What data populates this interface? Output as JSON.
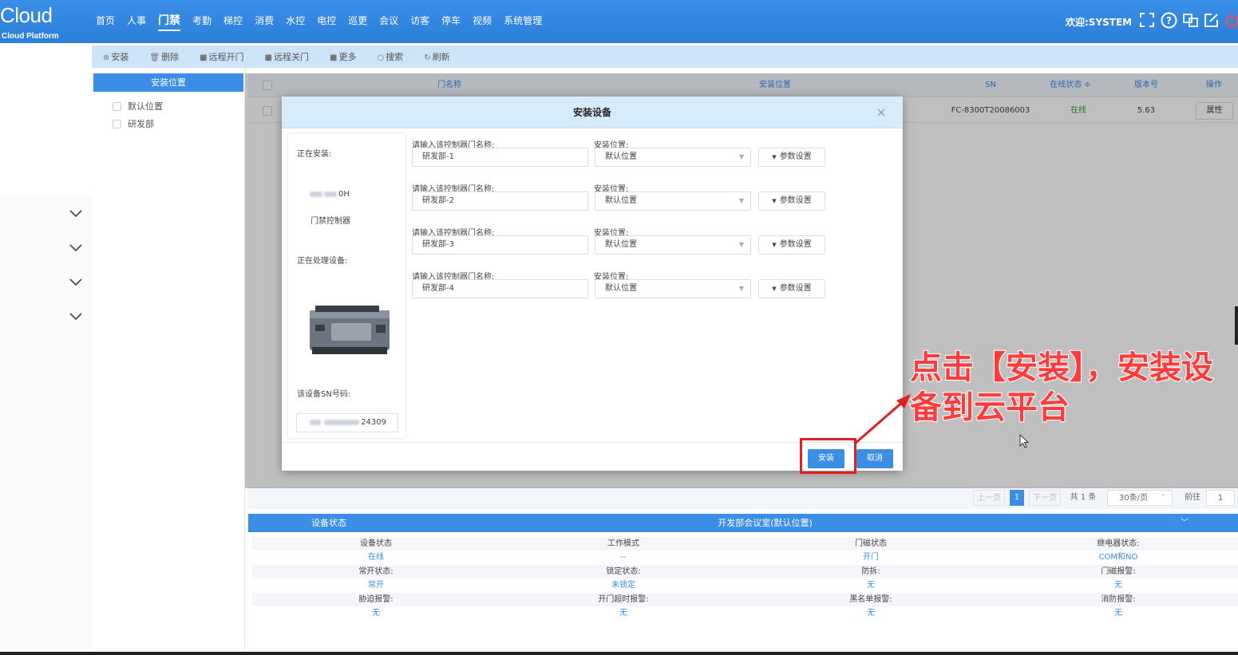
{
  "app": {
    "logo": "Cloud",
    "logo_sub": "Cloud Platform",
    "welcome": "欢迎:SYSTEM"
  },
  "nav": [
    {
      "label": "首页"
    },
    {
      "label": "人事"
    },
    {
      "label": "门禁",
      "active": true
    },
    {
      "label": "考勤"
    },
    {
      "label": "梯控"
    },
    {
      "label": "消费"
    },
    {
      "label": "水控"
    },
    {
      "label": "电控"
    },
    {
      "label": "巡更"
    },
    {
      "label": "会议"
    },
    {
      "label": "访客"
    },
    {
      "label": "停车"
    },
    {
      "label": "视频"
    },
    {
      "label": "系统管理"
    }
  ],
  "top_icons": [
    "fullscreen-icon",
    "help-icon",
    "language-icon",
    "edit-icon",
    "power-icon"
  ],
  "toolbar": {
    "install": "安装",
    "delete": "删除",
    "remote_open": "远程开门",
    "remote_close": "远程关门",
    "more": "更多",
    "search": "搜索",
    "refresh": "刷新"
  },
  "tree": {
    "header": "安装位置",
    "nodes": [
      "默认位置",
      "研发部"
    ]
  },
  "table": {
    "columns": [
      "门名称",
      "安装位置",
      "SN",
      "在线状态 ≑",
      "版本号",
      "操作"
    ],
    "row": {
      "sn": "FC-8300T20086003",
      "status": "在线",
      "version": "5.63",
      "action": "属性"
    }
  },
  "pagination": {
    "prev": "上一页",
    "page": "1",
    "next": "下一页",
    "total": "共 1 条",
    "per_page": "30条/页",
    "goto_label": "前往",
    "goto_value": "1"
  },
  "status_panel": {
    "title": "设备状态",
    "subtitle": "开发部会议室(默认位置)",
    "rows": [
      [
        {
          "label": "设备状态",
          "value": "在线"
        },
        {
          "label": "工作模式",
          "value": "--"
        },
        {
          "label": "门磁状态",
          "value": "开门"
        },
        {
          "label": "继电器状态:",
          "value": "COM和NO"
        }
      ],
      [
        {
          "label": "常开状态:",
          "value": "常开"
        },
        {
          "label": "锁定状态:",
          "value": "未锁定"
        },
        {
          "label": "防拆:",
          "value": "无"
        },
        {
          "label": "门磁报警:",
          "value": "无"
        }
      ],
      [
        {
          "label": "胁迫报警:",
          "value": "无"
        },
        {
          "label": "开门超时报警:",
          "value": "无"
        },
        {
          "label": "黑名单报警:",
          "value": "无"
        },
        {
          "label": "消防报警:",
          "value": "无"
        }
      ]
    ]
  },
  "modal": {
    "title": "安装设备",
    "installing_label": "正在安装:",
    "device_code_suffix": "0H",
    "device_type": "门禁控制器",
    "processing_label": "正在处理设备:",
    "sn_label": "该设备SN号码:",
    "sn_suffix": "24309",
    "name_label": "请输入该控制器门名称:",
    "location_label": "安装位置:",
    "param_label": "参数设置",
    "doors": [
      {
        "name": "研发部-1",
        "location": "默认位置"
      },
      {
        "name": "研发部-2",
        "location": "默认位置"
      },
      {
        "name": "研发部-3",
        "location": "默认位置"
      },
      {
        "name": "研发部-4",
        "location": "默认位置"
      }
    ],
    "install_btn": "安装",
    "cancel_btn": "取消"
  },
  "annotation": {
    "line1": "点击【安装】，安装设",
    "line2": "备到云平台"
  },
  "colors": {
    "primary": "#3a8ee6",
    "header_bg": "#2b7fd9",
    "annotation": "#ff3b3b",
    "highlight": "#e02020",
    "online": "#2a9d2a"
  }
}
